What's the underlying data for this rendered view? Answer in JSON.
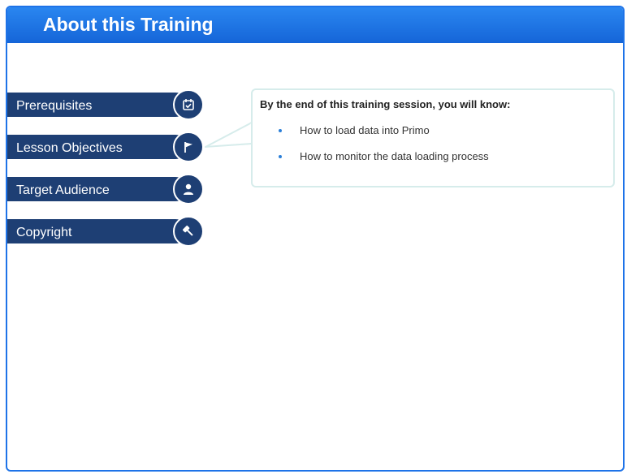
{
  "header": {
    "title": "About this Training"
  },
  "tabs": [
    {
      "label": "Prerequisites",
      "icon": "calendar-check-icon"
    },
    {
      "label": "Lesson Objectives",
      "icon": "flag-icon",
      "selected": true
    },
    {
      "label": "Target Audience",
      "icon": "user-icon"
    },
    {
      "label": "Copyright",
      "icon": "gavel-icon"
    }
  ],
  "callout": {
    "heading": "By the end of this training session, you will know:",
    "bullets": [
      "How to load data into Primo",
      "How to monitor the data loading process"
    ]
  },
  "colors": {
    "header_blue": "#1e73e8",
    "tab_navy": "#1e3f74",
    "callout_border": "#d6eceb",
    "bullet_blue": "#2b7fd8"
  }
}
